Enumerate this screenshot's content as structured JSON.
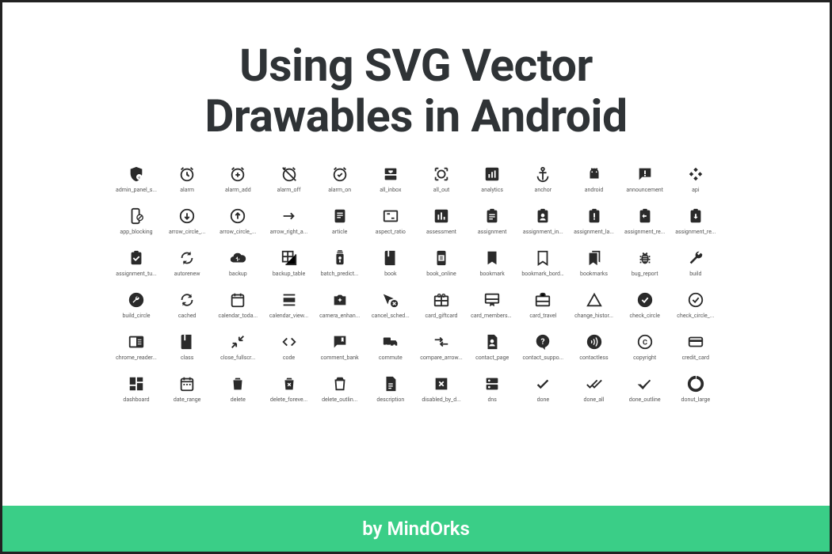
{
  "title_line1": "Using SVG Vector",
  "title_line2": "Drawables in Android",
  "footer": "by MindOrks",
  "colors": {
    "accent": "#3ace87",
    "text": "#2f3336"
  },
  "icons": [
    [
      {
        "id": "admin_panel_settings",
        "label": "admin_panel_s..."
      },
      {
        "id": "alarm",
        "label": "alarm"
      },
      {
        "id": "alarm_add",
        "label": "alarm_add"
      },
      {
        "id": "alarm_off",
        "label": "alarm_off"
      },
      {
        "id": "alarm_on",
        "label": "alarm_on"
      },
      {
        "id": "all_inbox",
        "label": "all_inbox"
      },
      {
        "id": "all_out",
        "label": "all_out"
      },
      {
        "id": "analytics",
        "label": "analytics"
      },
      {
        "id": "anchor",
        "label": "anchor"
      },
      {
        "id": "android",
        "label": "android"
      },
      {
        "id": "announcement",
        "label": "announcement"
      },
      {
        "id": "api",
        "label": "api"
      }
    ],
    [
      {
        "id": "app_blocking",
        "label": "app_blocking"
      },
      {
        "id": "arrow_circle_down",
        "label": "arrow_circle_..."
      },
      {
        "id": "arrow_circle_up",
        "label": "arrow_circle_..."
      },
      {
        "id": "arrow_right_alt",
        "label": "arrow_right_a..."
      },
      {
        "id": "article",
        "label": "article"
      },
      {
        "id": "aspect_ratio",
        "label": "aspect_ratio"
      },
      {
        "id": "assessment",
        "label": "assessment"
      },
      {
        "id": "assignment",
        "label": "assignment"
      },
      {
        "id": "assignment_ind",
        "label": "assignment_in..."
      },
      {
        "id": "assignment_late",
        "label": "assignment_la..."
      },
      {
        "id": "assignment_return",
        "label": "assignment_re..."
      },
      {
        "id": "assignment_returned",
        "label": "assignment_re..."
      }
    ],
    [
      {
        "id": "assignment_turned_in",
        "label": "assignment_tu..."
      },
      {
        "id": "autorenew",
        "label": "autorenew"
      },
      {
        "id": "backup",
        "label": "backup"
      },
      {
        "id": "backup_table",
        "label": "backup_table"
      },
      {
        "id": "batch_prediction",
        "label": "batch_predict..."
      },
      {
        "id": "book",
        "label": "book"
      },
      {
        "id": "book_online",
        "label": "book_online"
      },
      {
        "id": "bookmark",
        "label": "bookmark"
      },
      {
        "id": "bookmark_border",
        "label": "bookmark_bord..."
      },
      {
        "id": "bookmarks",
        "label": "bookmarks"
      },
      {
        "id": "bug_report",
        "label": "bug_report"
      },
      {
        "id": "build",
        "label": "build"
      }
    ],
    [
      {
        "id": "build_circle",
        "label": "build_circle"
      },
      {
        "id": "cached",
        "label": "cached"
      },
      {
        "id": "calendar_today",
        "label": "calendar_toda..."
      },
      {
        "id": "calendar_view_day",
        "label": "calendar_view..."
      },
      {
        "id": "camera_enhance",
        "label": "camera_enhan..."
      },
      {
        "id": "cancel_schedule_send",
        "label": "cancel_sched..."
      },
      {
        "id": "card_giftcard",
        "label": "card_giftcard"
      },
      {
        "id": "card_membership",
        "label": "card_membersh..."
      },
      {
        "id": "card_travel",
        "label": "card_travel"
      },
      {
        "id": "change_history",
        "label": "change_histor..."
      },
      {
        "id": "check_circle",
        "label": "check_circle"
      },
      {
        "id": "check_circle_outline",
        "label": "check_circle_..."
      }
    ],
    [
      {
        "id": "chrome_reader_mode",
        "label": "chrome_reader..."
      },
      {
        "id": "class",
        "label": "class"
      },
      {
        "id": "close_fullscreen",
        "label": "close_fullscr..."
      },
      {
        "id": "code",
        "label": "code"
      },
      {
        "id": "comment_bank",
        "label": "comment_bank"
      },
      {
        "id": "commute",
        "label": "commute"
      },
      {
        "id": "compare_arrows",
        "label": "compare_arrow..."
      },
      {
        "id": "contact_page",
        "label": "contact_page"
      },
      {
        "id": "contact_support",
        "label": "contact_suppo..."
      },
      {
        "id": "contactless",
        "label": "contactless"
      },
      {
        "id": "copyright",
        "label": "copyright"
      },
      {
        "id": "credit_card",
        "label": "credit_card"
      }
    ],
    [
      {
        "id": "dashboard",
        "label": "dashboard"
      },
      {
        "id": "date_range",
        "label": "date_range"
      },
      {
        "id": "delete",
        "label": "delete"
      },
      {
        "id": "delete_forever",
        "label": "delete_foreve..."
      },
      {
        "id": "delete_outline",
        "label": "delete_outlin..."
      },
      {
        "id": "description",
        "label": "description"
      },
      {
        "id": "disabled_by_default",
        "label": "disabled_by_d..."
      },
      {
        "id": "dns",
        "label": "dns"
      },
      {
        "id": "done",
        "label": "done"
      },
      {
        "id": "done_all",
        "label": "done_all"
      },
      {
        "id": "done_outline",
        "label": "done_outline"
      },
      {
        "id": "donut_large",
        "label": "donut_large"
      }
    ]
  ]
}
